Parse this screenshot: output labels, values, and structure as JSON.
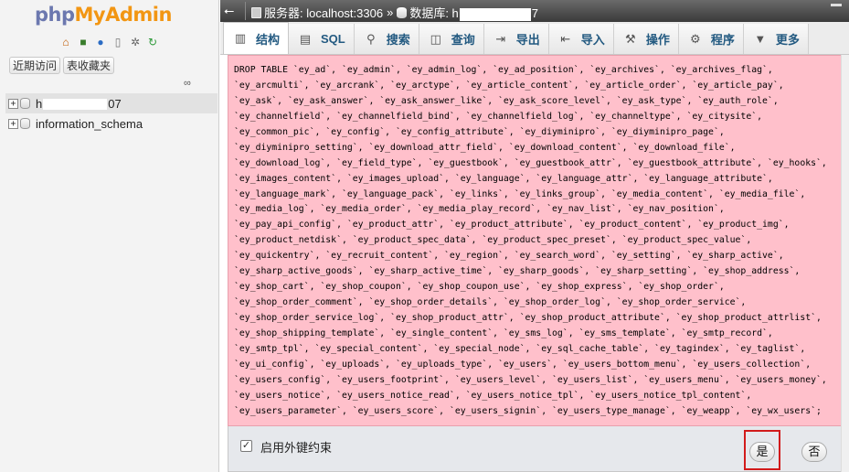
{
  "nav": {
    "logo_php": "php",
    "logo_my": "MyAdmin",
    "icons": [
      "home-icon",
      "exit-icon",
      "help-icon",
      "docs-icon",
      "settings-icon",
      "reload-icon"
    ],
    "recent_label": "近期访问",
    "favorites_label": "表收藏夹",
    "tree": [
      {
        "label_prefix": "h",
        "label_suffix": "07",
        "selected": true
      },
      {
        "label": "information_schema",
        "selected": false
      }
    ]
  },
  "breadcrumb": {
    "server_label": "服务器: localhost:3306",
    "separator": "»",
    "db_prefix": "数据库: h",
    "db_suffix": "7"
  },
  "tabs": [
    {
      "label": "结构",
      "icon": "structure-icon",
      "active": true
    },
    {
      "label": "SQL",
      "icon": "sql-icon",
      "active": false
    },
    {
      "label": "搜索",
      "icon": "search-icon",
      "active": false
    },
    {
      "label": "查询",
      "icon": "query-icon",
      "active": false
    },
    {
      "label": "导出",
      "icon": "export-icon",
      "active": false
    },
    {
      "label": "导入",
      "icon": "import-icon",
      "active": false
    },
    {
      "label": "操作",
      "icon": "operations-icon",
      "active": false
    },
    {
      "label": "程序",
      "icon": "routines-icon",
      "active": false
    },
    {
      "label": "更多",
      "icon": "more-icon",
      "active": false
    }
  ],
  "confirm": {
    "sql_lines": [
      "DROP TABLE `ey_ad`, `ey_admin`, `ey_admin_log`, `ey_ad_position`, `ey_archives`, `ey_archives_flag`,",
      "`ey_arcmulti`, `ey_arcrank`, `ey_arctype`, `ey_article_content`, `ey_article_order`, `ey_article_pay`,",
      "`ey_ask`, `ey_ask_answer`, `ey_ask_answer_like`, `ey_ask_score_level`, `ey_ask_type`, `ey_auth_role`,",
      "`ey_channelfield`, `ey_channelfield_bind`, `ey_channelfield_log`, `ey_channeltype`, `ey_citysite`,",
      "`ey_common_pic`, `ey_config`, `ey_config_attribute`, `ey_diyminipro`, `ey_diyminipro_page`,",
      "`ey_diyminipro_setting`, `ey_download_attr_field`, `ey_download_content`, `ey_download_file`,",
      "`ey_download_log`, `ey_field_type`, `ey_guestbook`, `ey_guestbook_attr`, `ey_guestbook_attribute`, `ey_hooks`,",
      "`ey_images_content`, `ey_images_upload`, `ey_language`, `ey_language_attr`, `ey_language_attribute`,",
      "`ey_language_mark`, `ey_language_pack`, `ey_links`, `ey_links_group`, `ey_media_content`, `ey_media_file`,",
      "`ey_media_log`, `ey_media_order`, `ey_media_play_record`, `ey_nav_list`, `ey_nav_position`,",
      "`ey_pay_api_config`, `ey_product_attr`, `ey_product_attribute`, `ey_product_content`, `ey_product_img`,",
      "`ey_product_netdisk`, `ey_product_spec_data`, `ey_product_spec_preset`, `ey_product_spec_value`,",
      "`ey_quickentry`, `ey_recruit_content`, `ey_region`, `ey_search_word`, `ey_setting`, `ey_sharp_active`,",
      "`ey_sharp_active_goods`, `ey_sharp_active_time`, `ey_sharp_goods`, `ey_sharp_setting`, `ey_shop_address`,",
      "`ey_shop_cart`, `ey_shop_coupon`, `ey_shop_coupon_use`, `ey_shop_express`, `ey_shop_order`,",
      "`ey_shop_order_comment`, `ey_shop_order_details`, `ey_shop_order_log`, `ey_shop_order_service`,",
      "`ey_shop_order_service_log`, `ey_shop_product_attr`, `ey_shop_product_attribute`, `ey_shop_product_attrlist`,",
      "`ey_shop_shipping_template`, `ey_single_content`, `ey_sms_log`, `ey_sms_template`, `ey_smtp_record`,",
      "`ey_smtp_tpl`, `ey_special_content`, `ey_special_node`, `ey_sql_cache_table`, `ey_tagindex`, `ey_taglist`,",
      "`ey_ui_config`, `ey_uploads`, `ey_uploads_type`, `ey_users`, `ey_users_bottom_menu`, `ey_users_collection`,",
      "`ey_users_config`, `ey_users_footprint`, `ey_users_level`, `ey_users_list`, `ey_users_menu`, `ey_users_money`,",
      "`ey_users_notice`, `ey_users_notice_read`, `ey_users_notice_tpl`, `ey_users_notice_tpl_content`,",
      "`ey_users_parameter`, `ey_users_score`, `ey_users_signin`, `ey_users_type_manage`, `ey_weapp`, `ey_wx_users`;"
    ],
    "fk_checkbox_checked": true,
    "fk_label": "启用外键约束",
    "yes_label": "是",
    "no_label": "否",
    "highlight_color": "#d21b1b"
  }
}
